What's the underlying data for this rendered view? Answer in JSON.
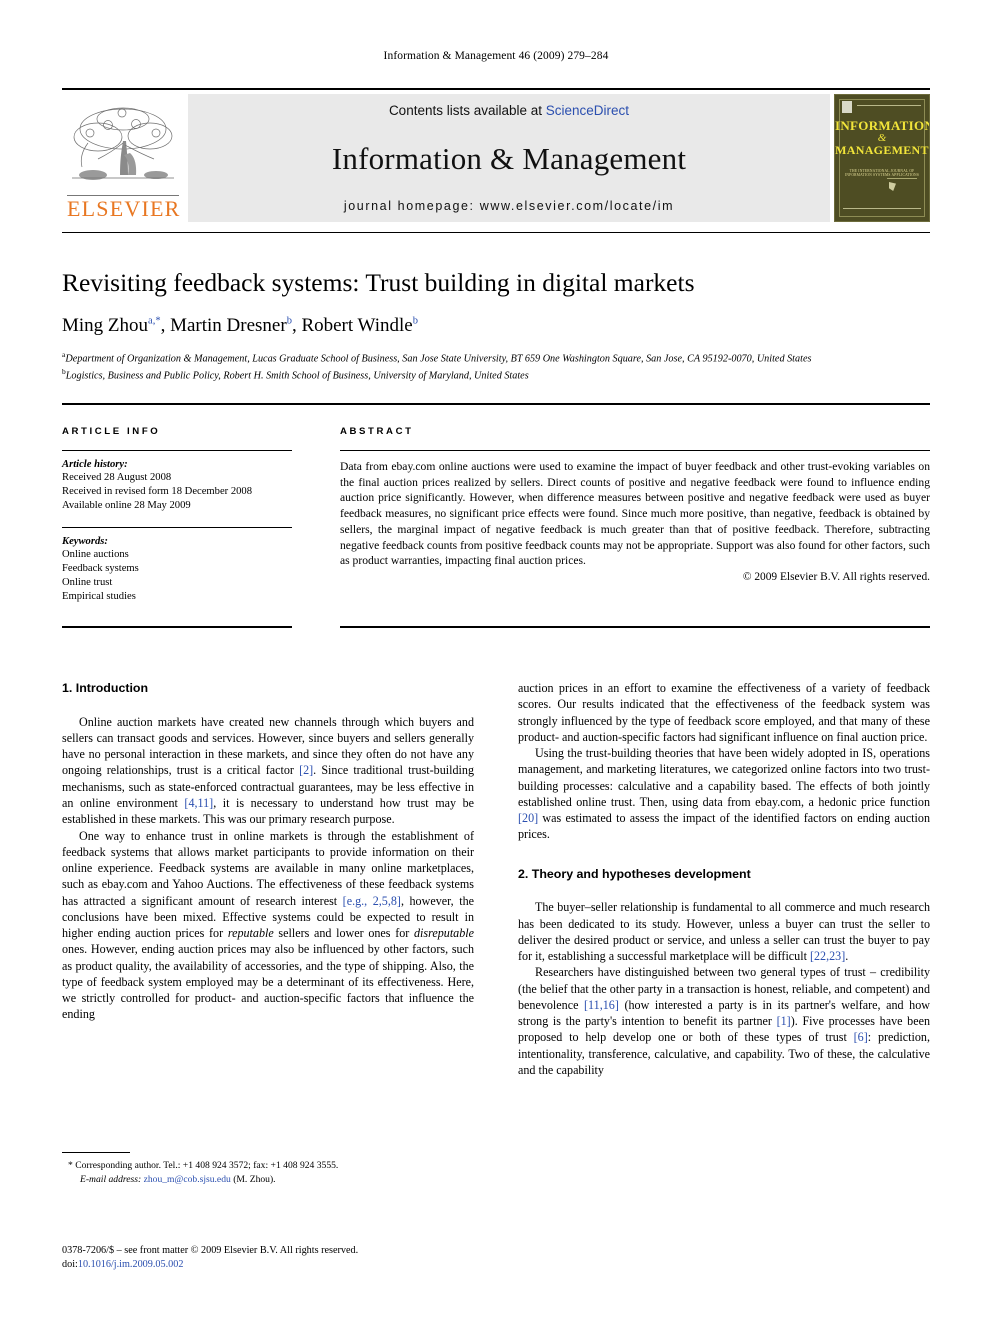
{
  "running_head": "Information & Management 46 (2009) 279–284",
  "masthead": {
    "elsevier_wordmark": "ELSEVIER",
    "contents_prefix": "Contents lists available at ",
    "contents_link": "ScienceDirect",
    "journal_title": "Information & Management",
    "homepage": "journal homepage: www.elsevier.com/locate/im",
    "cover": {
      "line1": "INFORMATION",
      "line2": "&",
      "line3": "MANAGEMENT",
      "subtitle": "THE INTERNATIONAL JOURNAL OF INFORMATION SYSTEMS APPLICATIONS"
    }
  },
  "article": {
    "title": "Revisiting feedback systems: Trust building in digital markets",
    "authors": [
      {
        "name": "Ming Zhou",
        "marks": "a,*"
      },
      {
        "name": "Martin Dresner",
        "marks": "b"
      },
      {
        "name": "Robert Windle",
        "marks": "b"
      }
    ],
    "affiliations": [
      {
        "mark": "a",
        "text": "Department of Organization & Management, Lucas Graduate School of Business, San Jose State University, BT 659 One Washington Square, San Jose, CA 95192-0070, United States"
      },
      {
        "mark": "b",
        "text": "Logistics, Business and Public Policy, Robert H. Smith School of Business, University of Maryland, United States"
      }
    ]
  },
  "article_info": {
    "heading": "ARTICLE INFO",
    "history_label": "Article history:",
    "history": [
      "Received 28 August 2008",
      "Received in revised form 18 December 2008",
      "Available online 28 May 2009"
    ],
    "keywords_label": "Keywords:",
    "keywords": [
      "Online auctions",
      "Feedback systems",
      "Online trust",
      "Empirical studies"
    ]
  },
  "abstract": {
    "heading": "ABSTRACT",
    "text": "Data from ebay.com online auctions were used to examine the impact of buyer feedback and other trust-evoking variables on the final auction prices realized by sellers. Direct counts of positive and negative feedback were found to influence ending auction price significantly. However, when difference measures between positive and negative feedback were used as buyer feedback measures, no significant price effects were found. Since much more positive, than negative, feedback is obtained by sellers, the marginal impact of negative feedback is much greater than that of positive feedback. Therefore, subtracting negative feedback counts from positive feedback counts may not be appropriate. Support was also found for other factors, such as product warranties, impacting final auction prices.",
    "copyright": "© 2009 Elsevier B.V. All rights reserved."
  },
  "body": {
    "left_column": {
      "section_heading": "1. Introduction",
      "paragraph_1_a": "Online auction markets have created new channels through which buyers and sellers can transact goods and services. However, since buyers and sellers generally have no personal interaction in these markets, and since they often do not have any ongoing relationships, trust is a critical factor ",
      "ref_1": "[2]",
      "paragraph_1_b": ". Since traditional trust-building mechanisms, such as state-enforced contractual guarantees, may be less effective in an online environment ",
      "ref_2": "[4,11]",
      "paragraph_1_c": ", it is necessary to understand how trust may be established in these markets. This was our primary research purpose.",
      "paragraph_2_a": "One way to enhance trust in online markets is through the establishment of feedback systems that allows market participants to provide information on their online experience. Feedback systems are available in many online marketplaces, such as ebay.com and Yahoo Auctions. The effectiveness of these feedback systems has attracted a significant amount of research interest ",
      "ref_3": "[e.g., 2,5,8]",
      "paragraph_2_b": ", however, the conclusions have been mixed. Effective systems could be expected to result in higher ending auction prices for ",
      "italic_1": "reputable",
      "paragraph_2_c": " sellers and lower ones for ",
      "italic_2": "disreputable",
      "paragraph_2_d": " ones. However, ending auction prices may also be influenced by other factors, such as product quality, the availability of accessories, and the type of shipping. Also, the type of feedback system employed may be a determinant of its effectiveness. Here, we strictly controlled for product- and auction-specific factors that influence the ending"
    },
    "right_column": {
      "paragraph_3": "auction prices in an effort to examine the effectiveness of a variety of feedback scores. Our results indicated that the effectiveness of the feedback system was strongly influenced by the type of feedback score employed, and that many of these product- and auction-specific factors had significant influence on final auction price.",
      "paragraph_4_a": "Using the trust-building theories that have been widely adopted in IS, operations management, and marketing literatures, we categorized online factors into two trust-building processes: calculative and a capability based. The effects of both jointly established online trust. Then, using data from ebay.com, a hedonic price function ",
      "ref_4": "[20]",
      "paragraph_4_b": " was estimated to assess the impact of the identified factors on ending auction prices.",
      "section_heading": "2. Theory and hypotheses development",
      "paragraph_5_a": "The buyer–seller relationship is fundamental to all commerce and much research has been dedicated to its study. However, unless a buyer can trust the seller to deliver the desired product or service, and unless a seller can trust the buyer to pay for it, establishing a successful marketplace will be difficult ",
      "ref_5": "[22,23]",
      "paragraph_5_b": ".",
      "paragraph_6_a": "Researchers have distinguished between two general types of trust – credibility (the belief that the other party in a transaction is honest, reliable, and competent) and benevolence ",
      "ref_6": "[11,16]",
      "paragraph_6_b": " (how interested a party is in its partner's welfare, and how strong is the party's intention to benefit its partner ",
      "ref_7": "[1]",
      "paragraph_6_c": "). Five processes have been proposed to help develop one or both of these types of trust ",
      "ref_8": "[6]",
      "paragraph_6_d": ": prediction, intentionality, transference, calculative, and capability. Two of these, the calculative and the capability"
    }
  },
  "footnote": {
    "corresponding": "* Corresponding author. Tel.: +1 408 924 3572; fax: +1 408 924 3555.",
    "email_label": "E-mail address:",
    "email": "zhou_m@cob.sjsu.edu",
    "email_suffix": " (M. Zhou)."
  },
  "imprint": {
    "line1": "0378-7206/$ – see front matter © 2009 Elsevier B.V. All rights reserved.",
    "doi_label": "doi:",
    "doi": "10.1016/j.im.2009.05.002"
  },
  "colors": {
    "link": "#2B4FAF",
    "elsevier_orange": "#E87722",
    "masthead_bg": "#e9e9e9",
    "cover_bg": "#4e4d23",
    "cover_text": "#f2e53a"
  }
}
